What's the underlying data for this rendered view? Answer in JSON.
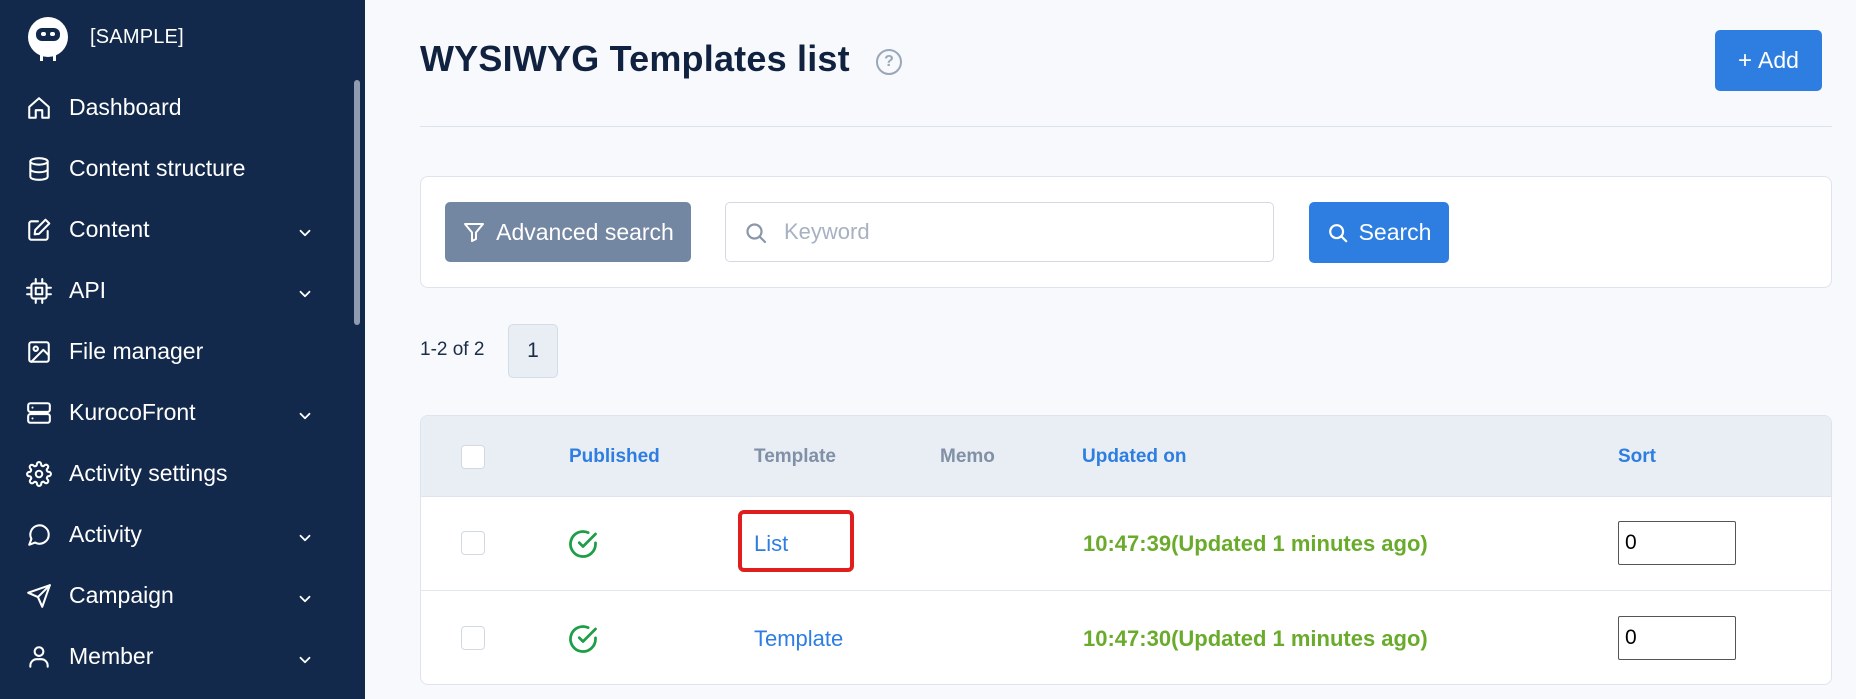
{
  "brand": {
    "name": "[SAMPLE]"
  },
  "sidebar": {
    "items": [
      {
        "label": "Dashboard",
        "icon": "home-icon",
        "expandable": false
      },
      {
        "label": "Content structure",
        "icon": "database-icon",
        "expandable": false
      },
      {
        "label": "Content",
        "icon": "edit-icon",
        "expandable": true
      },
      {
        "label": "API",
        "icon": "chip-icon",
        "expandable": true
      },
      {
        "label": "File manager",
        "icon": "image-icon",
        "expandable": false
      },
      {
        "label": "KurocoFront",
        "icon": "server-icon",
        "expandable": true
      },
      {
        "label": "Activity settings",
        "icon": "gear-icon",
        "expandable": false
      },
      {
        "label": "Activity",
        "icon": "chat-icon",
        "expandable": true
      },
      {
        "label": "Campaign",
        "icon": "send-icon",
        "expandable": true
      },
      {
        "label": "Member",
        "icon": "user-icon",
        "expandable": true
      }
    ]
  },
  "header": {
    "title": "WYSIWYG Templates list",
    "help": "?",
    "add_label": "Add",
    "add_icon": "+"
  },
  "search": {
    "advanced_label": "Advanced search",
    "keyword_placeholder": "Keyword",
    "keyword_value": "",
    "search_label": "Search"
  },
  "pagination": {
    "range": "1-2 of 2",
    "current_page": "1"
  },
  "table": {
    "headers": {
      "published": "Published",
      "template": "Template",
      "memo": "Memo",
      "updated_on": "Updated on",
      "sort": "Sort"
    },
    "rows": [
      {
        "template": "List",
        "memo": "",
        "updated_on": "10:47:39(Updated 1 minutes ago)",
        "sort": "0",
        "published": true,
        "highlighted": true
      },
      {
        "template": "Template",
        "memo": "",
        "updated_on": "10:47:30(Updated 1 minutes ago)",
        "sort": "0",
        "published": true,
        "highlighted": false
      }
    ]
  },
  "colors": {
    "sidebar_bg": "#13294b",
    "accent": "#2d7ee0",
    "published_green": "#1e9e46",
    "updated_green": "#6aab2c",
    "highlight_red": "#e01e1e"
  }
}
